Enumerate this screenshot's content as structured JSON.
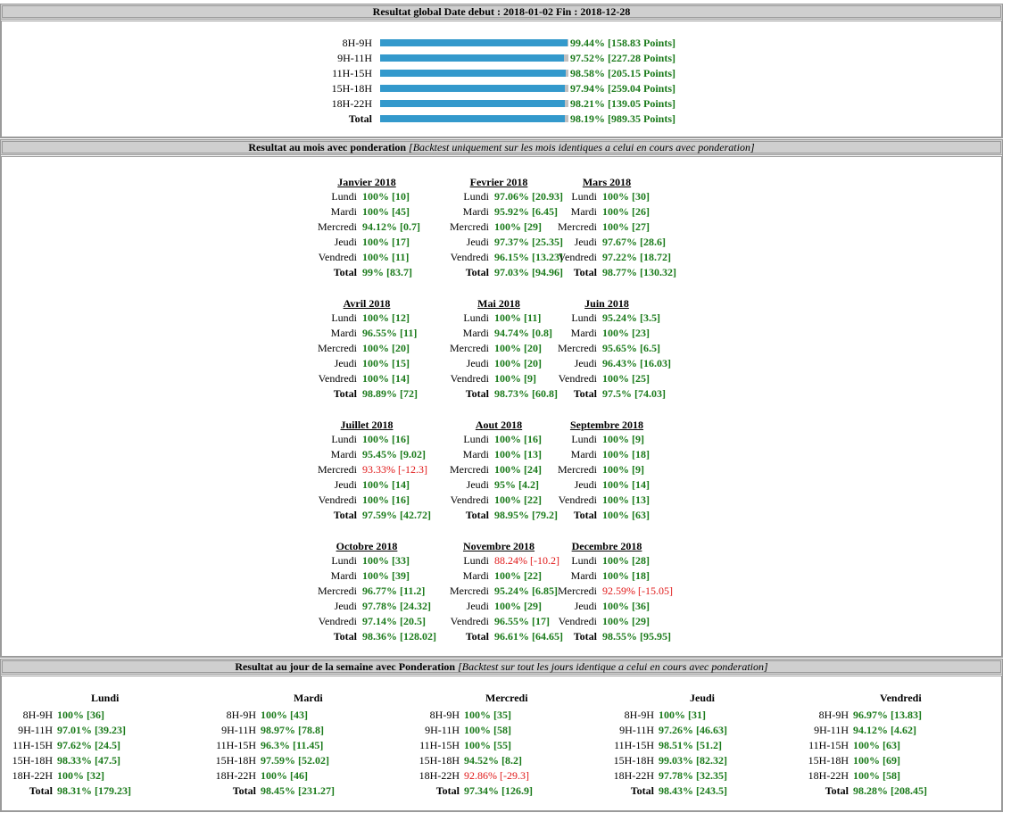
{
  "global": {
    "header": "Resultat global Date debut : 2018-01-02 Fin : 2018-12-28",
    "accent_color": "#3399cc",
    "rows": [
      {
        "label": "8H-9H",
        "pct": 99.44,
        "text": "99.44% [158.83 Points]"
      },
      {
        "label": "9H-11H",
        "pct": 97.52,
        "text": "97.52% [227.28 Points]"
      },
      {
        "label": "11H-15H",
        "pct": 98.58,
        "text": "98.58% [205.15 Points]"
      },
      {
        "label": "15H-18H",
        "pct": 97.94,
        "text": "97.94% [259.04 Points]"
      },
      {
        "label": "18H-22H",
        "pct": 98.21,
        "text": "98.21% [139.05 Points]"
      },
      {
        "label": "Total",
        "pct": 98.19,
        "text": "98.19% [989.35 Points]"
      }
    ]
  },
  "monthly": {
    "header": "Resultat au mois avec ponderation",
    "note": "[Backtest uniquement sur les mois identiques a celui en cours avec ponderation]",
    "months": [
      {
        "title": "Janvier 2018",
        "rows": [
          [
            "Lundi",
            "100% [10]",
            false
          ],
          [
            "Mardi",
            "100% [45]",
            false
          ],
          [
            "Mercredi",
            "94.12% [0.7]",
            false
          ],
          [
            "Jeudi",
            "100% [17]",
            false
          ],
          [
            "Vendredi",
            "100% [11]",
            false
          ],
          [
            "Total",
            "99% [83.7]",
            false
          ]
        ]
      },
      {
        "title": "Fevrier 2018",
        "rows": [
          [
            "Lundi",
            "97.06% [20.93]",
            false
          ],
          [
            "Mardi",
            "95.92% [6.45]",
            false
          ],
          [
            "Mercredi",
            "100% [29]",
            false
          ],
          [
            "Jeudi",
            "97.37% [25.35]",
            false
          ],
          [
            "Vendredi",
            "96.15% [13.23]",
            false
          ],
          [
            "Total",
            "97.03% [94.96]",
            false
          ]
        ]
      },
      {
        "title": "Mars 2018",
        "rows": [
          [
            "Lundi",
            "100% [30]",
            false
          ],
          [
            "Mardi",
            "100% [26]",
            false
          ],
          [
            "Mercredi",
            "100% [27]",
            false
          ],
          [
            "Jeudi",
            "97.67% [28.6]",
            false
          ],
          [
            "Vendredi",
            "97.22% [18.72]",
            false
          ],
          [
            "Total",
            "98.77% [130.32]",
            false
          ]
        ]
      },
      {
        "title": "Avril 2018",
        "rows": [
          [
            "Lundi",
            "100% [12]",
            false
          ],
          [
            "Mardi",
            "96.55% [11]",
            false
          ],
          [
            "Mercredi",
            "100% [20]",
            false
          ],
          [
            "Jeudi",
            "100% [15]",
            false
          ],
          [
            "Vendredi",
            "100% [14]",
            false
          ],
          [
            "Total",
            "98.89% [72]",
            false
          ]
        ]
      },
      {
        "title": "Mai 2018",
        "rows": [
          [
            "Lundi",
            "100% [11]",
            false
          ],
          [
            "Mardi",
            "94.74% [0.8]",
            false
          ],
          [
            "Mercredi",
            "100% [20]",
            false
          ],
          [
            "Jeudi",
            "100% [20]",
            false
          ],
          [
            "Vendredi",
            "100% [9]",
            false
          ],
          [
            "Total",
            "98.73% [60.8]",
            false
          ]
        ]
      },
      {
        "title": "Juin 2018",
        "rows": [
          [
            "Lundi",
            "95.24% [3.5]",
            false
          ],
          [
            "Mardi",
            "100% [23]",
            false
          ],
          [
            "Mercredi",
            "95.65% [6.5]",
            false
          ],
          [
            "Jeudi",
            "96.43% [16.03]",
            false
          ],
          [
            "Vendredi",
            "100% [25]",
            false
          ],
          [
            "Total",
            "97.5% [74.03]",
            false
          ]
        ]
      },
      {
        "title": "Juillet 2018",
        "rows": [
          [
            "Lundi",
            "100% [16]",
            false
          ],
          [
            "Mardi",
            "95.45% [9.02]",
            false
          ],
          [
            "Mercredi",
            "93.33% [-12.3]",
            true
          ],
          [
            "Jeudi",
            "100% [14]",
            false
          ],
          [
            "Vendredi",
            "100% [16]",
            false
          ],
          [
            "Total",
            "97.59% [42.72]",
            false
          ]
        ]
      },
      {
        "title": "Aout 2018",
        "rows": [
          [
            "Lundi",
            "100% [16]",
            false
          ],
          [
            "Mardi",
            "100% [13]",
            false
          ],
          [
            "Mercredi",
            "100% [24]",
            false
          ],
          [
            "Jeudi",
            "95% [4.2]",
            false
          ],
          [
            "Vendredi",
            "100% [22]",
            false
          ],
          [
            "Total",
            "98.95% [79.2]",
            false
          ]
        ]
      },
      {
        "title": "Septembre 2018",
        "rows": [
          [
            "Lundi",
            "100% [9]",
            false
          ],
          [
            "Mardi",
            "100% [18]",
            false
          ],
          [
            "Mercredi",
            "100% [9]",
            false
          ],
          [
            "Jeudi",
            "100% [14]",
            false
          ],
          [
            "Vendredi",
            "100% [13]",
            false
          ],
          [
            "Total",
            "100% [63]",
            false
          ]
        ]
      },
      {
        "title": "Octobre 2018",
        "rows": [
          [
            "Lundi",
            "100% [33]",
            false
          ],
          [
            "Mardi",
            "100% [39]",
            false
          ],
          [
            "Mercredi",
            "96.77% [11.2]",
            false
          ],
          [
            "Jeudi",
            "97.78% [24.32]",
            false
          ],
          [
            "Vendredi",
            "97.14% [20.5]",
            false
          ],
          [
            "Total",
            "98.36% [128.02]",
            false
          ]
        ]
      },
      {
        "title": "Novembre 2018",
        "rows": [
          [
            "Lundi",
            "88.24% [-10.2]",
            true
          ],
          [
            "Mardi",
            "100% [22]",
            false
          ],
          [
            "Mercredi",
            "95.24% [6.85]",
            false
          ],
          [
            "Jeudi",
            "100% [29]",
            false
          ],
          [
            "Vendredi",
            "96.55% [17]",
            false
          ],
          [
            "Total",
            "96.61% [64.65]",
            false
          ]
        ]
      },
      {
        "title": "Decembre 2018",
        "rows": [
          [
            "Lundi",
            "100% [28]",
            false
          ],
          [
            "Mardi",
            "100% [18]",
            false
          ],
          [
            "Mercredi",
            "92.59% [-15.05]",
            true
          ],
          [
            "Jeudi",
            "100% [36]",
            false
          ],
          [
            "Vendredi",
            "100% [29]",
            false
          ],
          [
            "Total",
            "98.55% [95.95]",
            false
          ]
        ]
      }
    ]
  },
  "weekday": {
    "header": "Resultat au jour de la semaine avec Ponderation",
    "note": "[Backtest sur tout les jours identique a celui en cours avec ponderation]",
    "days": [
      {
        "title": "Lundi",
        "rows": [
          [
            "8H-9H",
            "100% [36]",
            false
          ],
          [
            "9H-11H",
            "97.01% [39.23]",
            false
          ],
          [
            "11H-15H",
            "97.62% [24.5]",
            false
          ],
          [
            "15H-18H",
            "98.33% [47.5]",
            false
          ],
          [
            "18H-22H",
            "100% [32]",
            false
          ],
          [
            "Total",
            "98.31% [179.23]",
            false
          ]
        ]
      },
      {
        "title": "Mardi",
        "rows": [
          [
            "8H-9H",
            "100% [43]",
            false
          ],
          [
            "9H-11H",
            "98.97% [78.8]",
            false
          ],
          [
            "11H-15H",
            "96.3% [11.45]",
            false
          ],
          [
            "15H-18H",
            "97.59% [52.02]",
            false
          ],
          [
            "18H-22H",
            "100% [46]",
            false
          ],
          [
            "Total",
            "98.45% [231.27]",
            false
          ]
        ]
      },
      {
        "title": "Mercredi",
        "rows": [
          [
            "8H-9H",
            "100% [35]",
            false
          ],
          [
            "9H-11H",
            "100% [58]",
            false
          ],
          [
            "11H-15H",
            "100% [55]",
            false
          ],
          [
            "15H-18H",
            "94.52% [8.2]",
            false
          ],
          [
            "18H-22H",
            "92.86% [-29.3]",
            true
          ],
          [
            "Total",
            "97.34% [126.9]",
            false
          ]
        ]
      },
      {
        "title": "Jeudi",
        "rows": [
          [
            "8H-9H",
            "100% [31]",
            false
          ],
          [
            "9H-11H",
            "97.26% [46.63]",
            false
          ],
          [
            "11H-15H",
            "98.51% [51.2]",
            false
          ],
          [
            "15H-18H",
            "99.03% [82.32]",
            false
          ],
          [
            "18H-22H",
            "97.78% [32.35]",
            false
          ],
          [
            "Total",
            "98.43% [243.5]",
            false
          ]
        ]
      },
      {
        "title": "Vendredi",
        "rows": [
          [
            "8H-9H",
            "96.97% [13.83]",
            false
          ],
          [
            "9H-11H",
            "94.12% [4.62]",
            false
          ],
          [
            "11H-15H",
            "100% [63]",
            false
          ],
          [
            "15H-18H",
            "100% [69]",
            false
          ],
          [
            "18H-22H",
            "100% [58]",
            false
          ],
          [
            "Total",
            "98.28% [208.45]",
            false
          ]
        ]
      }
    ]
  }
}
